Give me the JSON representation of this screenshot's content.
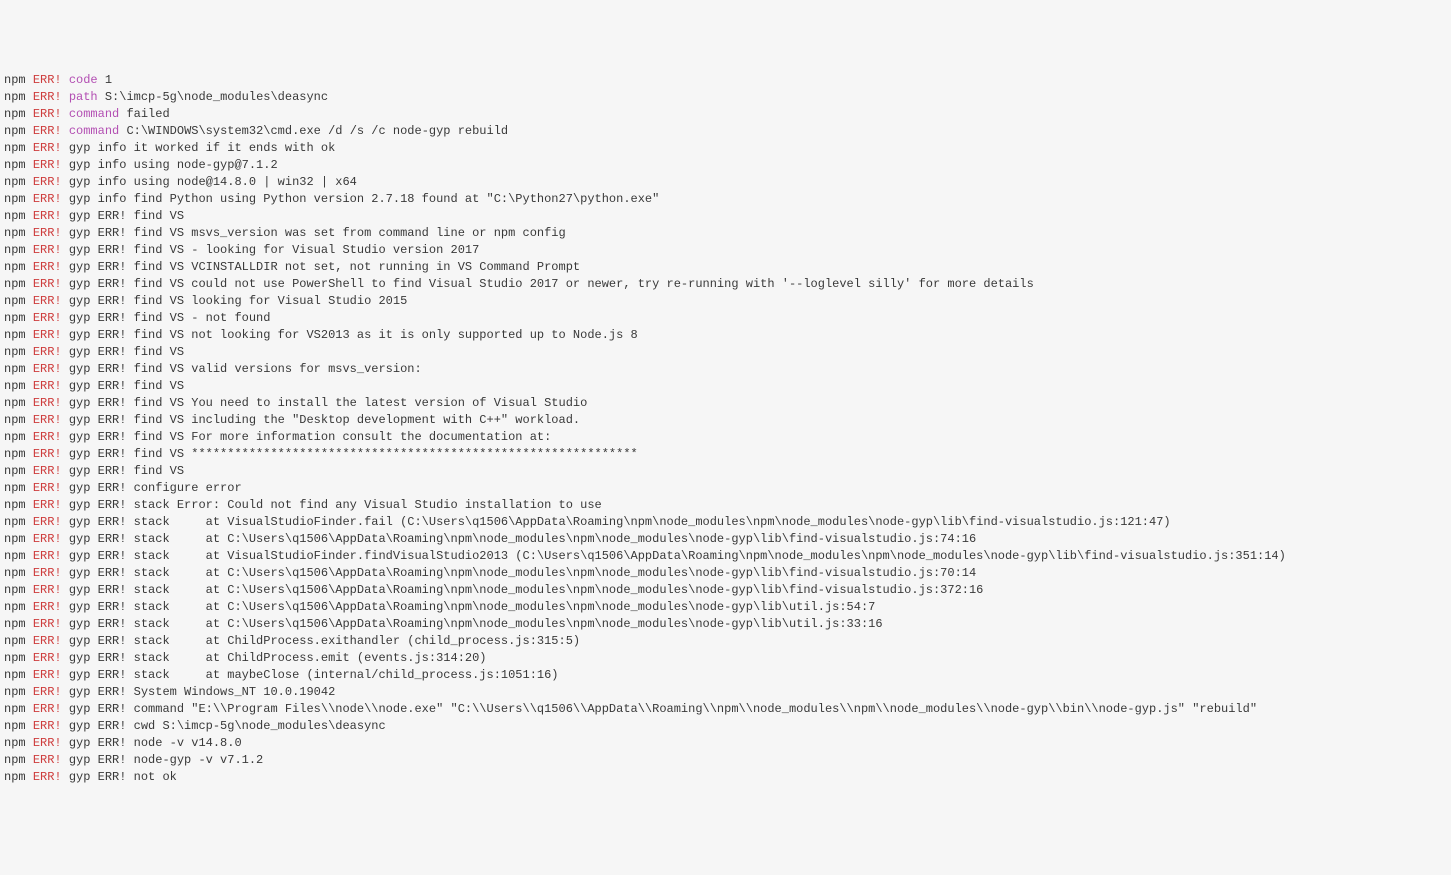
{
  "lines": [
    {
      "source": "npm",
      "tag": "ERR!",
      "key": "code",
      "text": "1"
    },
    {
      "source": "npm",
      "tag": "ERR!",
      "key": "path",
      "text": "S:\\imcp-5g\\node_modules\\deasync"
    },
    {
      "source": "npm",
      "tag": "ERR!",
      "key": "command",
      "text": "failed"
    },
    {
      "source": "npm",
      "tag": "ERR!",
      "key": "command",
      "text": "C:\\WINDOWS\\system32\\cmd.exe /d /s /c node-gyp rebuild"
    },
    {
      "source": "npm",
      "tag": "ERR!",
      "text": "gyp info it worked if it ends with ok"
    },
    {
      "source": "npm",
      "tag": "ERR!",
      "text": "gyp info using node-gyp@7.1.2"
    },
    {
      "source": "npm",
      "tag": "ERR!",
      "text": "gyp info using node@14.8.0 | win32 | x64"
    },
    {
      "source": "npm",
      "tag": "ERR!",
      "text": "gyp info find Python using Python version 2.7.18 found at \"C:\\Python27\\python.exe\""
    },
    {
      "source": "npm",
      "tag": "ERR!",
      "text": "gyp ERR! find VS"
    },
    {
      "source": "npm",
      "tag": "ERR!",
      "text": "gyp ERR! find VS msvs_version was set from command line or npm config"
    },
    {
      "source": "npm",
      "tag": "ERR!",
      "text": "gyp ERR! find VS - looking for Visual Studio version 2017"
    },
    {
      "source": "npm",
      "tag": "ERR!",
      "text": "gyp ERR! find VS VCINSTALLDIR not set, not running in VS Command Prompt"
    },
    {
      "source": "npm",
      "tag": "ERR!",
      "text": "gyp ERR! find VS could not use PowerShell to find Visual Studio 2017 or newer, try re-running with '--loglevel silly' for more details"
    },
    {
      "source": "npm",
      "tag": "ERR!",
      "text": "gyp ERR! find VS looking for Visual Studio 2015"
    },
    {
      "source": "npm",
      "tag": "ERR!",
      "text": "gyp ERR! find VS - not found"
    },
    {
      "source": "npm",
      "tag": "ERR!",
      "text": "gyp ERR! find VS not looking for VS2013 as it is only supported up to Node.js 8"
    },
    {
      "source": "npm",
      "tag": "ERR!",
      "text": "gyp ERR! find VS"
    },
    {
      "source": "npm",
      "tag": "ERR!",
      "text": "gyp ERR! find VS valid versions for msvs_version:"
    },
    {
      "source": "npm",
      "tag": "ERR!",
      "text": "gyp ERR! find VS"
    },
    {
      "source": "npm",
      "tag": "ERR!",
      "text": "gyp ERR! find VS You need to install the latest version of Visual Studio"
    },
    {
      "source": "npm",
      "tag": "ERR!",
      "text": "gyp ERR! find VS including the \"Desktop development with C++\" workload."
    },
    {
      "source": "npm",
      "tag": "ERR!",
      "text": "gyp ERR! find VS For more information consult the documentation at:"
    },
    {
      "source": "npm",
      "tag": "ERR!",
      "text": "gyp ERR! find VS **************************************************************"
    },
    {
      "source": "npm",
      "tag": "ERR!",
      "text": "gyp ERR! find VS"
    },
    {
      "source": "npm",
      "tag": "ERR!",
      "text": "gyp ERR! configure error"
    },
    {
      "source": "npm",
      "tag": "ERR!",
      "text": "gyp ERR! stack Error: Could not find any Visual Studio installation to use"
    },
    {
      "source": "npm",
      "tag": "ERR!",
      "text": "gyp ERR! stack     at VisualStudioFinder.fail (C:\\Users\\q1506\\AppData\\Roaming\\npm\\node_modules\\npm\\node_modules\\node-gyp\\lib\\find-visualstudio.js:121:47)"
    },
    {
      "source": "npm",
      "tag": "ERR!",
      "text": "gyp ERR! stack     at C:\\Users\\q1506\\AppData\\Roaming\\npm\\node_modules\\npm\\node_modules\\node-gyp\\lib\\find-visualstudio.js:74:16"
    },
    {
      "source": "npm",
      "tag": "ERR!",
      "text": "gyp ERR! stack     at VisualStudioFinder.findVisualStudio2013 (C:\\Users\\q1506\\AppData\\Roaming\\npm\\node_modules\\npm\\node_modules\\node-gyp\\lib\\find-visualstudio.js:351:14)"
    },
    {
      "source": "npm",
      "tag": "ERR!",
      "text": "gyp ERR! stack     at C:\\Users\\q1506\\AppData\\Roaming\\npm\\node_modules\\npm\\node_modules\\node-gyp\\lib\\find-visualstudio.js:70:14"
    },
    {
      "source": "npm",
      "tag": "ERR!",
      "text": "gyp ERR! stack     at C:\\Users\\q1506\\AppData\\Roaming\\npm\\node_modules\\npm\\node_modules\\node-gyp\\lib\\find-visualstudio.js:372:16"
    },
    {
      "source": "npm",
      "tag": "ERR!",
      "text": "gyp ERR! stack     at C:\\Users\\q1506\\AppData\\Roaming\\npm\\node_modules\\npm\\node_modules\\node-gyp\\lib\\util.js:54:7"
    },
    {
      "source": "npm",
      "tag": "ERR!",
      "text": "gyp ERR! stack     at C:\\Users\\q1506\\AppData\\Roaming\\npm\\node_modules\\npm\\node_modules\\node-gyp\\lib\\util.js:33:16"
    },
    {
      "source": "npm",
      "tag": "ERR!",
      "text": "gyp ERR! stack     at ChildProcess.exithandler (child_process.js:315:5)"
    },
    {
      "source": "npm",
      "tag": "ERR!",
      "text": "gyp ERR! stack     at ChildProcess.emit (events.js:314:20)"
    },
    {
      "source": "npm",
      "tag": "ERR!",
      "text": "gyp ERR! stack     at maybeClose (internal/child_process.js:1051:16)"
    },
    {
      "source": "npm",
      "tag": "ERR!",
      "text": "gyp ERR! System Windows_NT 10.0.19042"
    },
    {
      "source": "npm",
      "tag": "ERR!",
      "text": "gyp ERR! command \"E:\\\\Program Files\\\\node\\\\node.exe\" \"C:\\\\Users\\\\q1506\\\\AppData\\\\Roaming\\\\npm\\\\node_modules\\\\npm\\\\node_modules\\\\node-gyp\\\\bin\\\\node-gyp.js\" \"rebuild\""
    },
    {
      "source": "npm",
      "tag": "ERR!",
      "text": "gyp ERR! cwd S:\\imcp-5g\\node_modules\\deasync"
    },
    {
      "source": "npm",
      "tag": "ERR!",
      "text": "gyp ERR! node -v v14.8.0"
    },
    {
      "source": "npm",
      "tag": "ERR!",
      "text": "gyp ERR! node-gyp -v v7.1.2"
    },
    {
      "source": "npm",
      "tag": "ERR!",
      "text": "gyp ERR! not ok"
    }
  ]
}
